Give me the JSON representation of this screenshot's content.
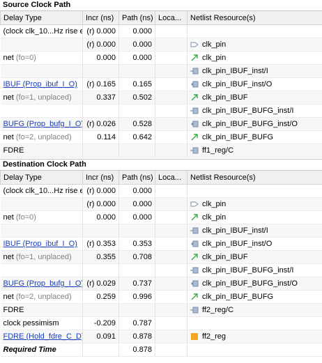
{
  "source": {
    "title": "Source Clock Path",
    "headers": [
      "Delay Type",
      "Incr (ns)",
      "Path (ns)",
      "Loca...",
      "Netlist Resource(s)"
    ],
    "rows": [
      {
        "type": "(clock clk_10...Hz rise edge)",
        "incr": "(r) 0.000",
        "path": "0.000",
        "loc": "",
        "res": "",
        "icon": ""
      },
      {
        "type": "",
        "incr": "(r) 0.000",
        "path": "0.000",
        "loc": "",
        "res": "clk_pin",
        "icon": "port-in-icon"
      },
      {
        "type": "net",
        "fo": " (fo=0)",
        "incr": "0.000",
        "path": "0.000",
        "loc": "",
        "res": "clk_pin",
        "icon": "net-icon"
      },
      {
        "type": "",
        "incr": "",
        "path": "",
        "loc": "",
        "res": "clk_pin_IBUF_inst/I",
        "icon": "pin-in-icon"
      },
      {
        "type": "IBUF (Prop_ibuf_I_O)",
        "link": true,
        "incr": "(r) 0.165",
        "path": "0.165",
        "loc": "",
        "res": "clk_pin_IBUF_inst/O",
        "icon": "pin-out-icon"
      },
      {
        "type": "net",
        "fo": " (fo=1, unplaced)",
        "incr": "0.337",
        "path": "0.502",
        "loc": "",
        "res": "clk_pin_IBUF",
        "icon": "net-icon"
      },
      {
        "type": "",
        "incr": "",
        "path": "",
        "loc": "",
        "res": "clk_pin_IBUF_BUFG_inst/I",
        "icon": "pin-in-icon"
      },
      {
        "type": "BUFG (Prop_bufg_I_O)",
        "link": true,
        "incr": "(r) 0.026",
        "path": "0.528",
        "loc": "",
        "res": "clk_pin_IBUF_BUFG_inst/O",
        "icon": "pin-out-icon"
      },
      {
        "type": "net",
        "fo": " (fo=2, unplaced)",
        "incr": "0.114",
        "path": "0.642",
        "loc": "",
        "res": "clk_pin_IBUF_BUFG",
        "icon": "net-icon"
      },
      {
        "type": "FDRE",
        "incr": "",
        "path": "",
        "loc": "",
        "res": "ff1_reg/C",
        "icon": "pin-in-icon"
      }
    ]
  },
  "destination": {
    "title": "Destination Clock Path",
    "headers": [
      "Delay Type",
      "Incr (ns)",
      "Path (ns)",
      "Loca...",
      "Netlist Resource(s)"
    ],
    "rows": [
      {
        "type": "(clock clk_10...Hz rise edge)",
        "incr": "(r) 0.000",
        "path": "0.000",
        "loc": "",
        "res": "",
        "icon": ""
      },
      {
        "type": "",
        "incr": "(r) 0.000",
        "path": "0.000",
        "loc": "",
        "res": "clk_pin",
        "icon": "port-in-icon"
      },
      {
        "type": "net",
        "fo": " (fo=0)",
        "incr": "0.000",
        "path": "0.000",
        "loc": "",
        "res": "clk_pin",
        "icon": "net-icon"
      },
      {
        "type": "",
        "incr": "",
        "path": "",
        "loc": "",
        "res": "clk_pin_IBUF_inst/I",
        "icon": "pin-in-icon"
      },
      {
        "type": "IBUF (Prop_ibuf_I_O)",
        "link": true,
        "incr": "(r) 0.353",
        "path": "0.353",
        "loc": "",
        "res": "clk_pin_IBUF_inst/O",
        "icon": "pin-out-icon"
      },
      {
        "type": "net",
        "fo": " (fo=1, unplaced)",
        "incr": "0.355",
        "path": "0.708",
        "loc": "",
        "res": "clk_pin_IBUF",
        "icon": "net-icon"
      },
      {
        "type": "",
        "incr": "",
        "path": "",
        "loc": "",
        "res": "clk_pin_IBUF_BUFG_inst/I",
        "icon": "pin-in-icon"
      },
      {
        "type": "BUFG (Prop_bufg_I_O)",
        "link": true,
        "incr": "(r) 0.029",
        "path": "0.737",
        "loc": "",
        "res": "clk_pin_IBUF_BUFG_inst/O",
        "icon": "pin-out-icon"
      },
      {
        "type": "net",
        "fo": " (fo=2, unplaced)",
        "incr": "0.259",
        "path": "0.996",
        "loc": "",
        "res": "clk_pin_IBUF_BUFG",
        "icon": "net-icon"
      },
      {
        "type": "FDRE",
        "incr": "",
        "path": "",
        "loc": "",
        "res": "ff2_reg/C",
        "icon": "pin-in-icon"
      },
      {
        "type": "clock pessimism",
        "incr": "-0.209",
        "path": "0.787",
        "loc": "",
        "res": "",
        "icon": ""
      },
      {
        "type": "FDRE (Hold_fdre_C_D)",
        "link": true,
        "incr": "0.091",
        "path": "0.878",
        "loc": "",
        "res": "ff2_reg",
        "icon": "cell-icon"
      },
      {
        "type": "Required Time",
        "boldItalic": true,
        "incr": "",
        "path": "0.878",
        "loc": "",
        "res": "",
        "icon": ""
      }
    ]
  },
  "colors": {
    "link": "#1a3fb5",
    "net_icon": "#3aa845",
    "cell_icon": "#f5a623",
    "pin_icon": "#7a8ea8"
  }
}
